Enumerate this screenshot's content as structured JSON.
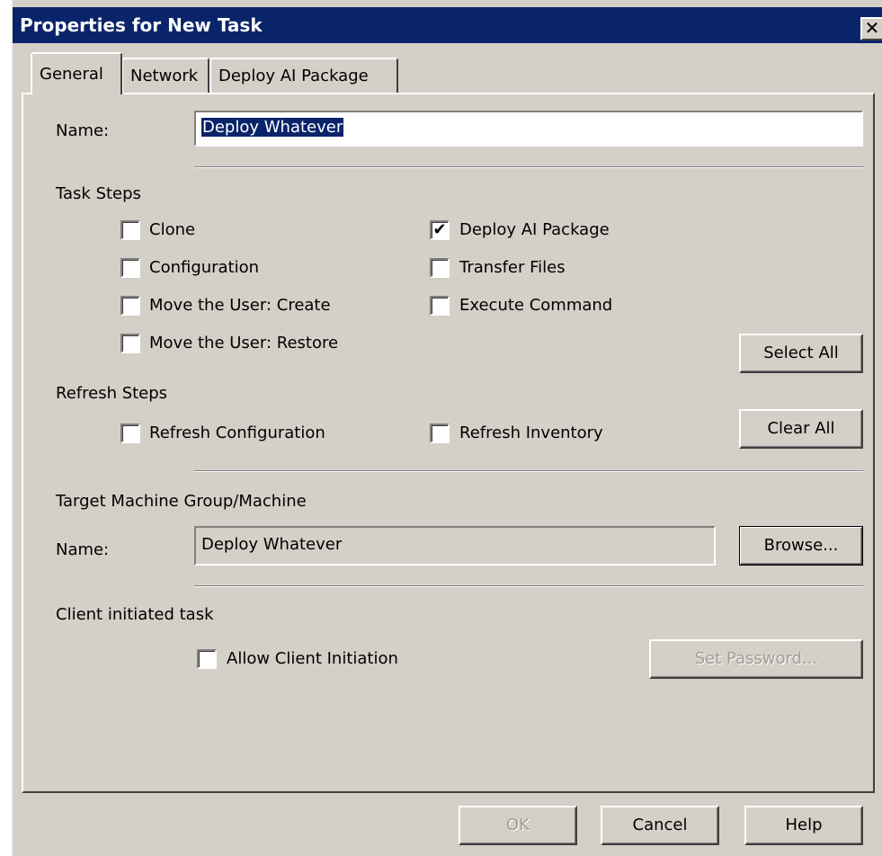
{
  "window": {
    "title": "Properties for New Task",
    "close_glyph": "✕",
    "close_icon": "close-icon"
  },
  "tabs": [
    {
      "label": "General",
      "active": true
    },
    {
      "label": "Network",
      "active": false
    },
    {
      "label": "Deploy AI Package",
      "active": false
    }
  ],
  "general": {
    "name_label": "Name:",
    "name_value": "Deploy Whatever",
    "task_steps_label": "Task Steps",
    "task_steps": [
      {
        "label": "Clone",
        "checked": false
      },
      {
        "label": "Configuration",
        "checked": false
      },
      {
        "label": "Move the User: Create",
        "checked": false
      },
      {
        "label": "Move the User: Restore",
        "checked": false
      },
      {
        "label": "Deploy AI Package",
        "checked": true
      },
      {
        "label": "Transfer Files",
        "checked": false
      },
      {
        "label": "Execute Command",
        "checked": false
      }
    ],
    "select_all_label": "Select All",
    "clear_all_label": "Clear All",
    "refresh_steps_label": "Refresh Steps",
    "refresh_steps": [
      {
        "label": "Refresh Configuration",
        "checked": false
      },
      {
        "label": "Refresh Inventory",
        "checked": false
      }
    ],
    "target_label": "Target Machine Group/Machine",
    "target_name_label": "Name:",
    "target_name_value": "Deploy Whatever",
    "browse_label": "Browse...",
    "client_label": "Client initiated task",
    "allow_client": {
      "label": "Allow Client Initiation",
      "checked": false
    },
    "set_password_label": "Set Password..."
  },
  "footer": {
    "ok_label": "OK",
    "cancel_label": "Cancel",
    "help_label": "Help"
  },
  "check_glyph": "✔",
  "colors": {
    "titlebar": "#0a246a",
    "face": "#d4d0c8",
    "selection": "#0a246a"
  }
}
